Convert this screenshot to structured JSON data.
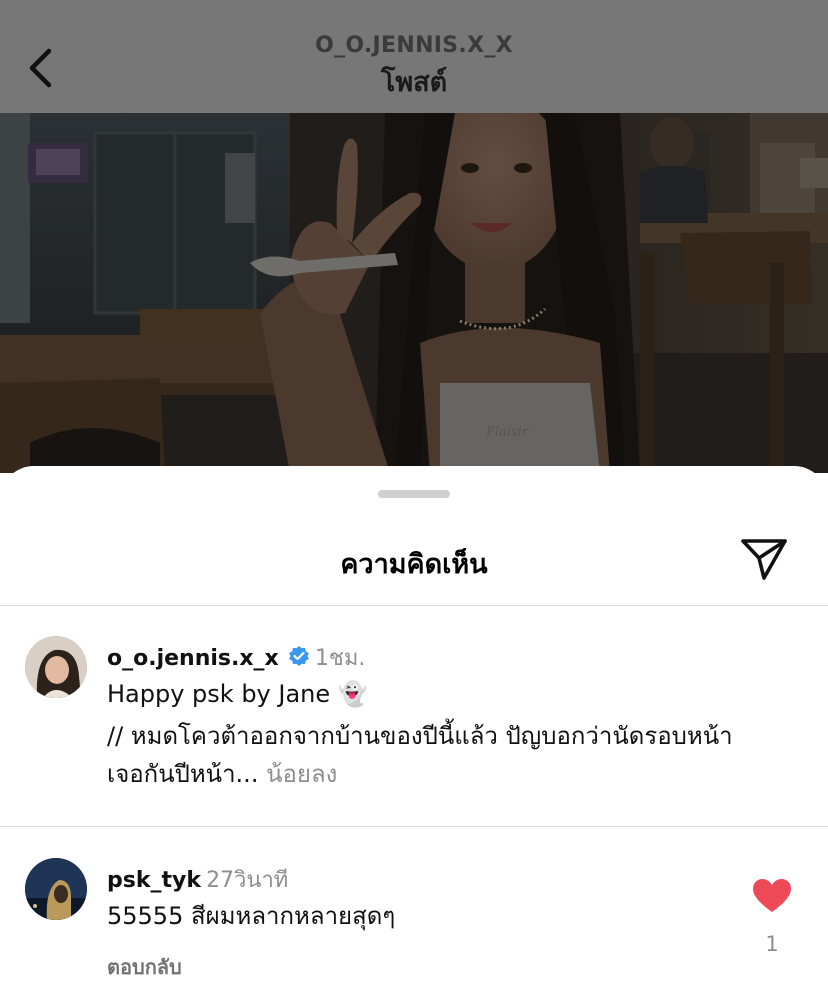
{
  "header": {
    "back_icon": "chevron-left-icon",
    "username": "O_O.JENNIS.X_X",
    "title": "โพสต์"
  },
  "photo": {
    "shirt_text": "Flaisir"
  },
  "comments_sheet": {
    "title": "ความคิดเห็น",
    "share_icon": "paper-plane-icon",
    "caption": {
      "username": "o_o.jennis.x_x",
      "verified_icon": "verified-badge-icon",
      "time": "1ชม.",
      "line1": "Happy psk by Jane 👻",
      "line2": "// หมดโควต้าออกจากบ้านของปีนี้แล้ว ปัญบอกว่านัดรอบหน้า",
      "line3": "เจอกันปีหน้า...",
      "more_label": "น้อยลง"
    },
    "comment": {
      "username": "psk_tyk",
      "time": "27วินาที",
      "text": "55555 สีผมหลากหลายสุดๆ",
      "reply_label": "ตอบกลับ",
      "heart_icon": "heart-filled-icon",
      "like_count": "1",
      "heart_color": "#ed4956"
    }
  }
}
